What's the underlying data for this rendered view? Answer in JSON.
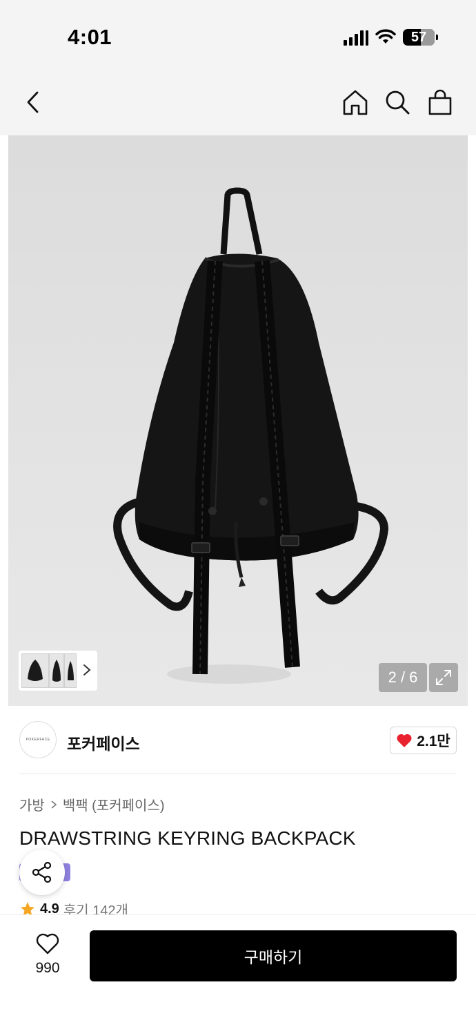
{
  "status_bar": {
    "time": "4:01",
    "battery": "57",
    "battery_level": 0.57,
    "icons": [
      "cellular-signal-icon",
      "wifi-icon",
      "battery-icon"
    ]
  },
  "nav": {
    "icons": [
      "back-chevron-icon",
      "home-icon",
      "search-icon",
      "shopping-bag-icon"
    ]
  },
  "gallery": {
    "counter": "2 / 6",
    "current": 2,
    "total": 6,
    "icons": [
      "expand-icon",
      "chevron-right-icon"
    ]
  },
  "brand": {
    "logo_text": "POKERFACE",
    "name": "포커페이스",
    "like_count": "2.1만",
    "accent": "#e8222e"
  },
  "product": {
    "breadcrumb": [
      "가방",
      "백팩 (포커페이스)"
    ],
    "title": "DRAWSTRING KEYRING BACKPACK",
    "rating": "4.9",
    "reviews": "후기 142개",
    "tag_color": "#7b6cd9"
  },
  "bottom_bar": {
    "wish_count": "990",
    "buy_label": "구매하기"
  }
}
